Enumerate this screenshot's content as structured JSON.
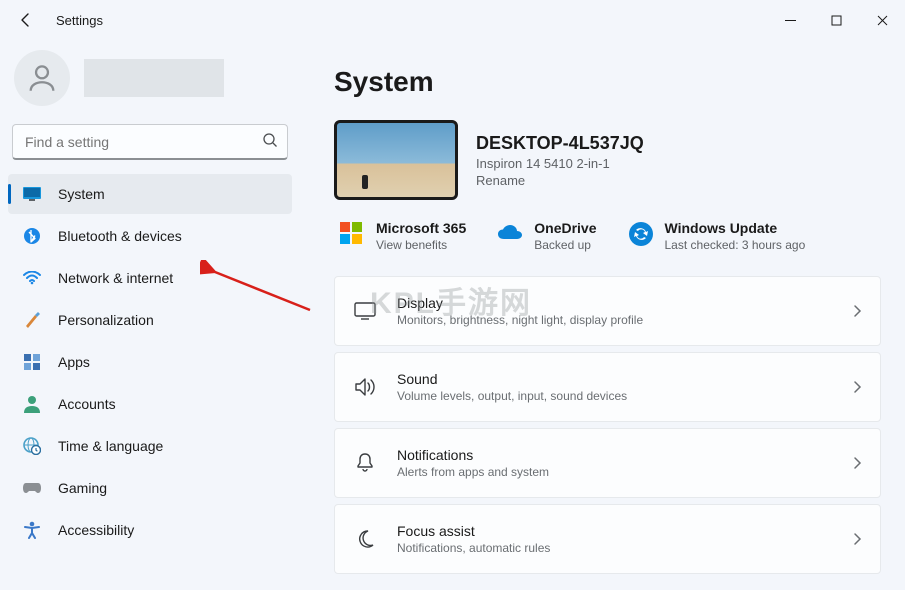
{
  "titlebar": {
    "title": "Settings"
  },
  "search": {
    "placeholder": "Find a setting"
  },
  "nav": {
    "items": [
      {
        "label": "System"
      },
      {
        "label": "Bluetooth & devices"
      },
      {
        "label": "Network & internet"
      },
      {
        "label": "Personalization"
      },
      {
        "label": "Apps"
      },
      {
        "label": "Accounts"
      },
      {
        "label": "Time & language"
      },
      {
        "label": "Gaming"
      },
      {
        "label": "Accessibility"
      }
    ]
  },
  "page": {
    "title": "System"
  },
  "device": {
    "name": "DESKTOP-4L537JQ",
    "model": "Inspiron 14 5410 2-in-1",
    "rename": "Rename"
  },
  "services": {
    "ms365": {
      "title": "Microsoft 365",
      "sub": "View benefits"
    },
    "onedrive": {
      "title": "OneDrive",
      "sub": "Backed up"
    },
    "update": {
      "title": "Windows Update",
      "sub": "Last checked: 3 hours ago"
    }
  },
  "cards": {
    "display": {
      "title": "Display",
      "sub": "Monitors, brightness, night light, display profile"
    },
    "sound": {
      "title": "Sound",
      "sub": "Volume levels, output, input, sound devices"
    },
    "notifications": {
      "title": "Notifications",
      "sub": "Alerts from apps and system"
    },
    "focus": {
      "title": "Focus assist",
      "sub": "Notifications, automatic rules"
    }
  },
  "watermark": "KPL手游网"
}
